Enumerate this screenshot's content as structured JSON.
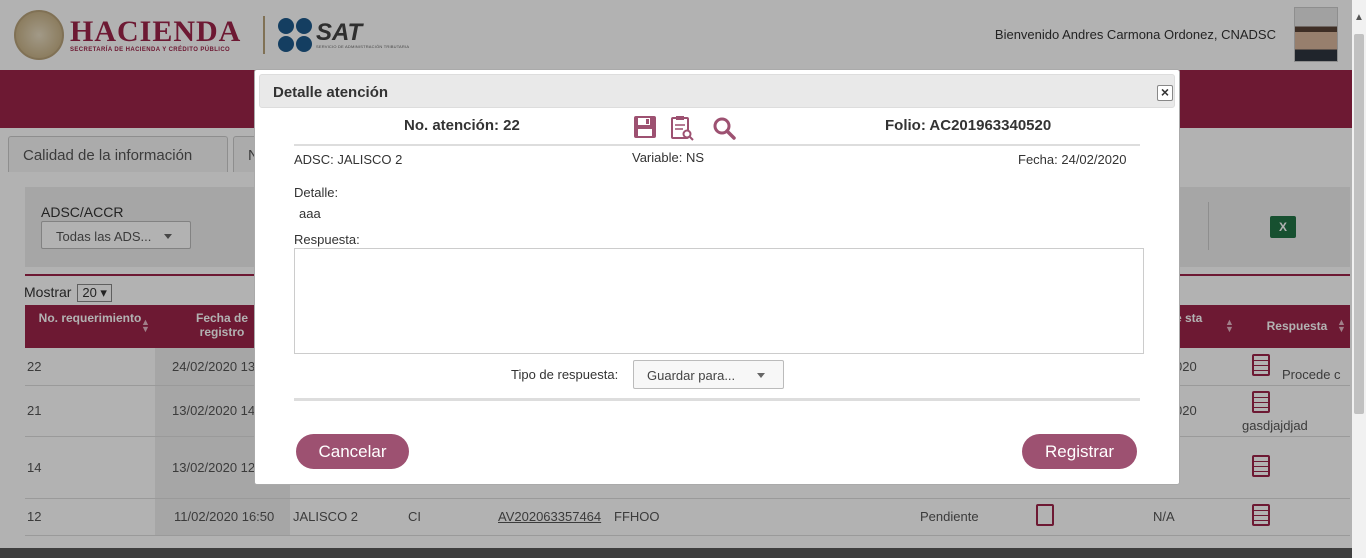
{
  "header": {
    "logo_hacienda_title": "HACIENDA",
    "logo_hacienda_sub": "SECRETARÍA DE HACIENDA Y CRÉDITO PÚBLICO",
    "logo_sat_title": "SAT",
    "logo_sat_sub": "SERVICIO DE ADMINISTRACIÓN TRIBUTARIA",
    "welcome": "Bienvenido Andres Carmona Ordonez, CNADSC"
  },
  "tabs": [
    {
      "label": "Calidad de la información"
    },
    {
      "label": "N"
    }
  ],
  "filters": {
    "adsc_label": "ADSC/ACCR",
    "adsc_value": "Todas las ADS..."
  },
  "table": {
    "mostrar_label": "Mostrar",
    "page_size": "20",
    "headers": {
      "no": "No. requerimiento",
      "fecha": "Fecha de registro",
      "fecha_resp": "de sta",
      "respuesta": "Respuesta"
    },
    "rows": [
      {
        "no": "22",
        "fecha": "24/02/2020 13",
        "fecha_resp": "020",
        "respuesta": "Procede c"
      },
      {
        "no": "21",
        "fecha": "13/02/2020 14",
        "fecha_resp": "020",
        "respuesta": "gasdjajdjad"
      },
      {
        "no": "14",
        "fecha": "13/02/2020 12",
        "fecha_resp": "",
        "respuesta": ""
      },
      {
        "no": "12",
        "fecha": "11/02/2020 16:50",
        "adsc": "JALISCO 2",
        "variable": "CI",
        "folio": "AV202063357464",
        "detalle": "FFHOO",
        "estatus": "Pendiente",
        "fecha_resp": "N/A",
        "respuesta": ""
      }
    ]
  },
  "modal": {
    "title": "Detalle atención",
    "no_atencion": "No. atención: 22",
    "folio": "Folio: AC201963340520",
    "adsc": "ADSC: JALISCO 2",
    "variable": "Variable: NS",
    "fecha": "Fecha: 24/02/2020",
    "detalle_label": "Detalle:",
    "detalle_value": "aaa",
    "respuesta_label": "Respuesta:",
    "respuesta_value": "",
    "tipo_label": "Tipo de respuesta:",
    "tipo_value": "Guardar para...",
    "cancel_label": "Cancelar",
    "submit_label": "Registrar",
    "close_glyph": "×"
  },
  "colors": {
    "brand": "#9d2449",
    "button": "#9d5171"
  }
}
